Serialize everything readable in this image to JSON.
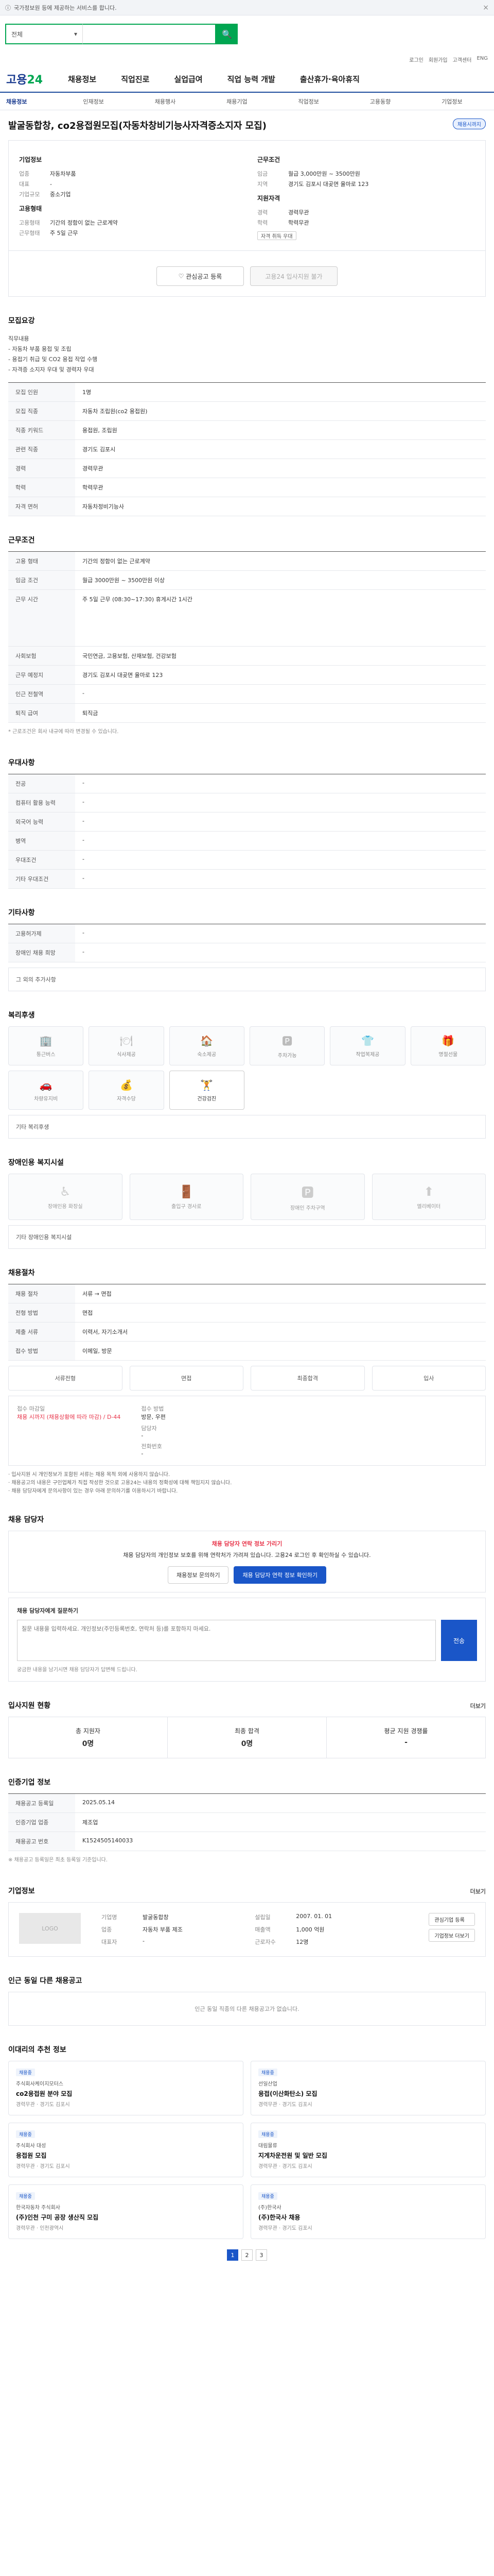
{
  "topbar": {
    "notice": "국가정보원 등에 제공하는 서비스를 합니다.",
    "close": "×"
  },
  "search": {
    "select": "전체",
    "placeholder": "",
    "btn": "🔍"
  },
  "util": [
    "로그인",
    "회원가입",
    "고객센터",
    "ENG"
  ],
  "brand": {
    "logo_a": "고용",
    "logo_b": "24"
  },
  "nav": [
    "채용정보",
    "직업진로",
    "실업급여",
    "직업 능력 개발",
    "출산휴가·육아휴직"
  ],
  "subnav": [
    "채용정보",
    "인재정보",
    "채용행사",
    "채용기업",
    "직업정보",
    "고용동향",
    "기업정보"
  ],
  "job": {
    "title": "발굴동합창, co2용접원모집(자동차창비기능사자격증소지자 모집)",
    "status": "채용시까지",
    "company_h": "기업정보",
    "company": [
      [
        "업종",
        "자동차부품"
      ],
      [
        "대표",
        "-"
      ],
      [
        "기업규모",
        "중소기업"
      ]
    ],
    "cond_h": "근무조건",
    "cond": [
      [
        "임금",
        "월급 3,000만원 ~ 3500만원"
      ],
      [
        "지역",
        "경기도 김포시 대곶면 율마로 123"
      ]
    ],
    "qual_h": "지원자격",
    "qual": [
      [
        "경력",
        "경력무관"
      ],
      [
        "학력",
        "학력무관"
      ]
    ],
    "employ_h": "고용형태",
    "employ": [
      [
        "고용형태",
        "기간의 정함이 없는 근로계약"
      ],
      [
        "근무형태",
        "주 5일 근무"
      ]
    ],
    "tag": "자격 취득 우대",
    "btn_interest": "관심공고 등록",
    "btn_apply": "고용24 입사지원 불가"
  },
  "sections": {
    "recruit": "모집요강",
    "work": "근무조건",
    "prefer": "우대사항",
    "other": "기타사항",
    "welfare": "복리후생",
    "disabled": "장애인용 복지시설",
    "process": "채용절차",
    "contact": "채용 담당자",
    "stats": "입사지원 현황",
    "regist": "인증기업 정보",
    "company": "기업정보",
    "nearby": "인근 동일 다른 채용공고",
    "recs": "이대리의 추천 정보"
  },
  "recruit_notice": [
    "직무내용",
    "- 자동차 부품 용접 및 조립",
    "- 용접기 취급 및 CO2 용접 작업 수행",
    "- 자격증 소지자 우대 및 경력자 우대"
  ],
  "recruit_rows": [
    [
      "모집 인원",
      "1명"
    ],
    [
      "모집 직종",
      "자동차 조립원(co2 용접원)"
    ],
    [
      "직종 키워드",
      "용접원, 조립원"
    ],
    [
      "관련 직종",
      "경기도 김포시"
    ],
    [
      "경력",
      "경력무관"
    ],
    [
      "학력",
      "학력무관"
    ],
    [
      "자격 면허",
      "자동차정비기능사"
    ]
  ],
  "work_rows": [
    [
      "고용 형태",
      "기간의 정함이 없는 근로계약"
    ],
    [
      "임금 조건",
      "월급 3000만원 ~ 3500만원 이상"
    ],
    [
      "근무 시간",
      "주 5일 근무 (08:30~17:30) 휴게시간 1시간"
    ],
    [
      "사회보험",
      "국민연금, 고용보험, 산재보험, 건강보험"
    ],
    [
      "근무 예정지",
      "경기도 김포시 대곶면 율마로 123"
    ],
    [
      "인근 전철역",
      "-"
    ],
    [
      "퇴직 급여",
      "퇴직금"
    ]
  ],
  "work_footnote": "* 근로조건은 회사 내규에 따라 변경될 수 있습니다.",
  "prefer_rows": [
    [
      "전공",
      "-"
    ],
    [
      "컴퓨터 활용 능력",
      "-"
    ],
    [
      "외국어 능력",
      "-"
    ],
    [
      "병역",
      "-"
    ],
    [
      "우대조건",
      "-"
    ],
    [
      "기타 우대조건",
      "-"
    ]
  ],
  "other_rows": [
    [
      "고용허가제",
      "-"
    ],
    [
      "장애인 채용 희망",
      "-"
    ]
  ],
  "other_note": "그 외의 추가사항",
  "welfare_items": [
    {
      "icon": "🏢",
      "label": "통근버스",
      "on": false
    },
    {
      "icon": "🍽",
      "label": "식사제공",
      "on": false
    },
    {
      "icon": "🏠",
      "label": "숙소제공",
      "on": false
    },
    {
      "icon": "🅿",
      "label": "주차가능",
      "on": false
    },
    {
      "icon": "👕",
      "label": "작업복제공",
      "on": false
    },
    {
      "icon": "🎁",
      "label": "명절선물",
      "on": false
    },
    {
      "icon": "🚗",
      "label": "차량유지비",
      "on": false
    },
    {
      "icon": "💰",
      "label": "자격수당",
      "on": false
    },
    {
      "icon": "🏋",
      "label": "건강검진",
      "on": true
    }
  ],
  "welfare_note": "기타 복리후생",
  "facil_items": [
    {
      "icon": "♿",
      "label": "장애인용 화장실"
    },
    {
      "icon": "🚪",
      "label": "출입구 경사로"
    },
    {
      "icon": "🅿",
      "label": "장애인 주차구역"
    },
    {
      "icon": "⬆",
      "label": "엘리베이터"
    }
  ],
  "facil_note": "기타 장애인용 복지시설",
  "process_rows": [
    [
      "채용 절차",
      "서류 → 면접"
    ],
    [
      "전형 방법",
      "면접"
    ],
    [
      "제출 서류",
      "이력서, 자기소개서"
    ],
    [
      "접수 방법",
      "이메일, 방문"
    ]
  ],
  "process_steps": [
    "서류전형",
    "면접",
    "최종합격",
    "입사"
  ],
  "contact": {
    "deadline_k": "접수 마감일",
    "deadline": "채용 시까지 (채용상황에 따라 마감) / D-44",
    "method_k": "접수 방법",
    "method": "방문, 우편",
    "person_k": "담당자",
    "person": "-",
    "phone_k": "전화번호",
    "phone": "-"
  },
  "warnings": [
    "· 입사지원 시 개인정보가 포함된 서류는 채용 목적 외에 사용하지 않습니다.",
    "· 채용공고의 내용은 구인업체가 직접 작성한 것으로 고용24는 내용의 정확성에 대해 책임지지 않습니다.",
    "· 채용 담당자에게 문의사항이 있는 경우 아래 문의하기를 이용하시기 바랍니다."
  ],
  "ask": {
    "head": "채용 담당자 연락 정보 가리기",
    "text": "채용 담당자의 개인정보 보호를 위해 연락처가 가려져 있습니다. 고용24 로그인 후 확인하실 수 있습니다.",
    "b1": "채용정보 문의하기",
    "b2": "채용 담당자 연락 정보 확인하기"
  },
  "qa": {
    "title": "채용 담당자에게 질문하기",
    "placeholder": "질문 내용을 입력하세요. 개인정보(주민등록번호, 연락처 등)를 포함하지 마세요.",
    "send": "전송",
    "hint": "궁금한 내용을 남기시면 채용 담당자가 답변해 드립니다."
  },
  "stats_items": [
    {
      "label": "총 지원자",
      "value": "0명"
    },
    {
      "label": "최종 합격",
      "value": "0명"
    },
    {
      "label": "평균 지원 경쟁률",
      "value": "-"
    }
  ],
  "stats_more": "더보기",
  "regist_rows": [
    [
      "채용공고 등록일",
      "2025.05.14"
    ],
    [
      "인증기업 업종",
      "제조업"
    ],
    [
      "채용공고 번호",
      "K1524505140033"
    ]
  ],
  "regist_note": "※ 채용공고 등록일은 최초 등록일 기준입니다.",
  "company_info": {
    "logo": "LOGO",
    "more": "더보기",
    "fields": [
      [
        "기업명",
        "발굴동합창"
      ],
      [
        "설립일",
        "2007. 01. 01"
      ],
      [
        "업종",
        "자동차 부품 제조"
      ],
      [
        "매출액",
        "1,000 억원"
      ],
      [
        "대표자",
        "-"
      ],
      [
        "근로자수",
        "12명"
      ]
    ],
    "b1": "관심기업 등록",
    "b2": "기업정보 더보기"
  },
  "nearby_text": "인근 동일 직종의 다른 채용공고가 없습니다.",
  "recs_items": [
    {
      "tag": "채용중",
      "company": "주식회사케이지모터스",
      "title": "co2용접원 분야 모집",
      "meta": "경력무관 · 경기도 김포시"
    },
    {
      "tag": "채용중",
      "company": "선일산업",
      "title": "용접(이산화탄소) 모집",
      "meta": "경력무관 · 경기도 김포시"
    },
    {
      "tag": "채용중",
      "company": "주식회사 대성",
      "title": "용접원 모집",
      "meta": "경력무관 · 경기도 김포시"
    },
    {
      "tag": "채용중",
      "company": "대림물류",
      "title": "지게차운전원 및 일반 모집",
      "meta": "경력무관 · 경기도 김포시"
    },
    {
      "tag": "채용중",
      "company": "한국자동차 주식회사",
      "title": "(주)인천 구미 공장 생산직 모집",
      "meta": "경력무관 · 인천광역시"
    },
    {
      "tag": "채용중",
      "company": "(주)한국사",
      "title": "(주)한국사 채용",
      "meta": "경력무관 · 경기도 김포시"
    }
  ],
  "pager": [
    "1",
    "2",
    "3"
  ]
}
